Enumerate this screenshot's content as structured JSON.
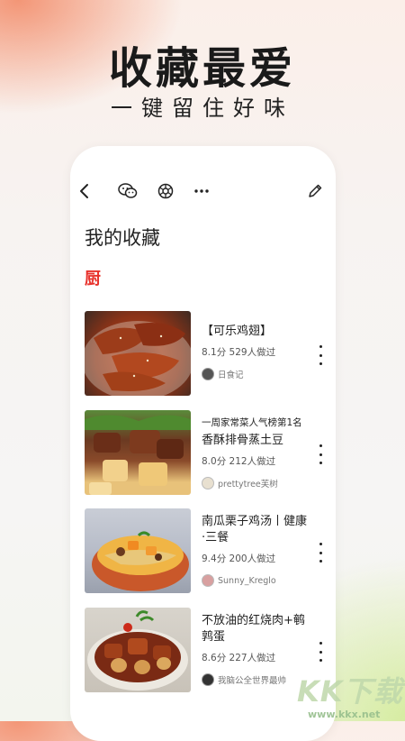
{
  "hero": {
    "title": "收藏最爱",
    "subtitle": "一键留住好味"
  },
  "page": {
    "title": "我的收藏",
    "section_badge": "厨",
    "accent_color": "#e8322c"
  },
  "toolbar": {
    "icons": [
      "back-icon",
      "wechat-icon",
      "share-icon",
      "more-icon",
      "edit-icon"
    ]
  },
  "recipes": [
    {
      "tag": "",
      "title": "【可乐鸡翅】",
      "meta": "8.1分 529人做过",
      "author": "日食记"
    },
    {
      "tag": "一周家常菜人气榜第1名",
      "title": "香酥排骨蒸土豆",
      "meta": "8.0分 212人做过",
      "author": "prettytree芙树"
    },
    {
      "tag": "",
      "title": "南瓜栗子鸡汤丨健康·三餐",
      "meta": "9.4分 200人做过",
      "author": "Sunny_Kreglo"
    },
    {
      "tag": "",
      "title": "不放油的红烧肉+鹌鹑蛋",
      "meta": "8.6分 227人做过",
      "author": "我脑公全世界最帅"
    }
  ],
  "watermark": {
    "brand": "KK下载",
    "url": "www.kkx.net"
  }
}
